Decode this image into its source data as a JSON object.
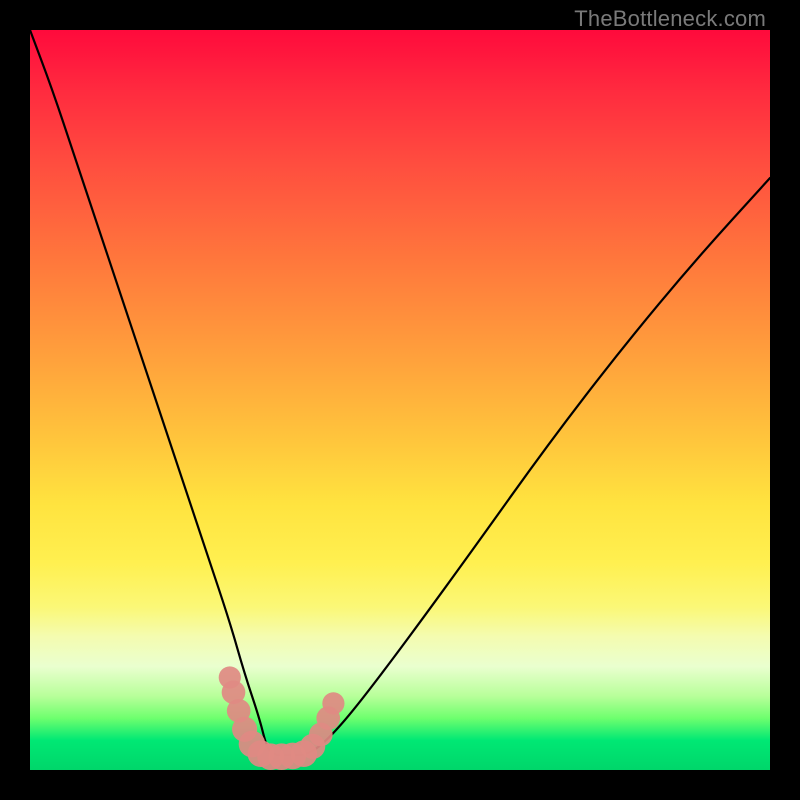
{
  "watermark": "TheBottleneck.com",
  "chart_data": {
    "type": "line",
    "title": "",
    "xlabel": "",
    "ylabel": "",
    "xlim": [
      0,
      100
    ],
    "ylim": [
      0,
      100
    ],
    "grid": false,
    "legend": false,
    "background_gradient_stops": [
      {
        "pos": 0,
        "color": "#ff0a3c"
      },
      {
        "pos": 32,
        "color": "#ff7a3c"
      },
      {
        "pos": 64,
        "color": "#ffe33f"
      },
      {
        "pos": 86,
        "color": "#eaffcf"
      },
      {
        "pos": 100,
        "color": "#00d66a"
      }
    ],
    "series": [
      {
        "name": "bottleneck-curve",
        "color": "#000000",
        "x": [
          0,
          3,
          6,
          9,
          12,
          15,
          18,
          21,
          24,
          27,
          29,
          31,
          32,
          33,
          35,
          37,
          39,
          42,
          46,
          52,
          60,
          70,
          80,
          90,
          100
        ],
        "y": [
          100,
          92,
          83,
          74,
          65,
          56,
          47,
          38,
          29,
          20,
          13,
          7,
          3,
          2,
          2,
          2,
          3,
          6,
          11,
          19,
          30,
          44,
          57,
          69,
          80
        ]
      }
    ],
    "overlays": [
      {
        "name": "bottom-blobs",
        "type": "marker-cluster",
        "color": "#e08a83",
        "points": [
          {
            "x": 27.0,
            "y": 12.5,
            "r": 1.5
          },
          {
            "x": 27.5,
            "y": 10.5,
            "r": 1.6
          },
          {
            "x": 28.2,
            "y": 8.0,
            "r": 1.6
          },
          {
            "x": 29.0,
            "y": 5.5,
            "r": 1.7
          },
          {
            "x": 30.0,
            "y": 3.5,
            "r": 1.8
          },
          {
            "x": 31.2,
            "y": 2.2,
            "r": 1.8
          },
          {
            "x": 32.5,
            "y": 1.8,
            "r": 1.8
          },
          {
            "x": 34.0,
            "y": 1.8,
            "r": 1.8
          },
          {
            "x": 35.5,
            "y": 1.9,
            "r": 1.8
          },
          {
            "x": 37.0,
            "y": 2.2,
            "r": 1.8
          },
          {
            "x": 38.2,
            "y": 3.2,
            "r": 1.7
          },
          {
            "x": 39.3,
            "y": 4.8,
            "r": 1.6
          },
          {
            "x": 40.3,
            "y": 7.0,
            "r": 1.6
          },
          {
            "x": 41.0,
            "y": 9.0,
            "r": 1.5
          }
        ]
      }
    ],
    "notes": "y=0 at bottom (green); y=100 at top (red). Curve is a V shape with minimum near x≈33–37 at y≈2. Right arm rises to y≈80 at x=100."
  }
}
